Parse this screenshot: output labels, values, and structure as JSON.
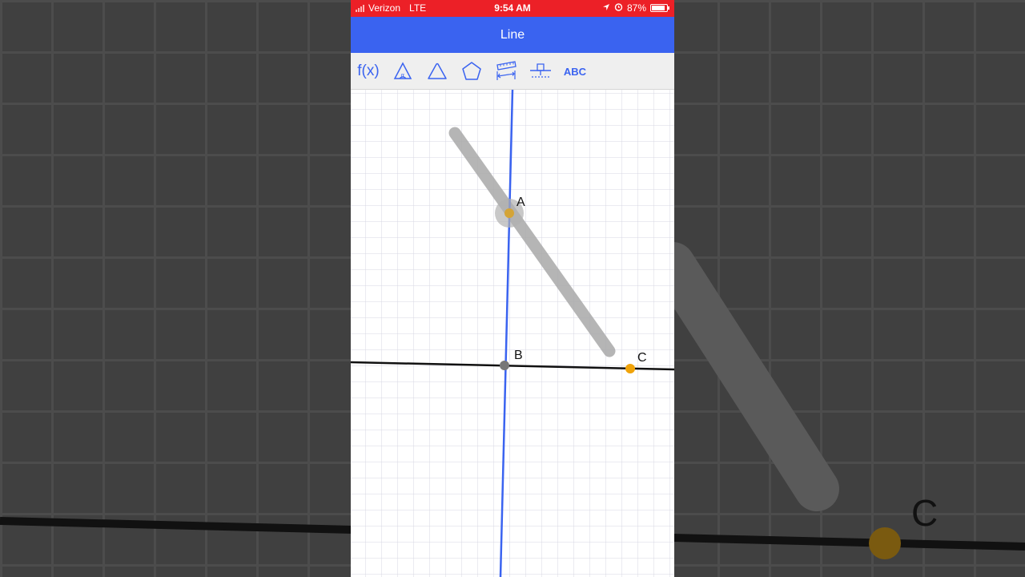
{
  "status_bar": {
    "carrier": "Verizon",
    "network": "LTE",
    "time": "9:54 AM",
    "battery": "87%",
    "battery_level": 0.87
  },
  "title": "Line",
  "toolbar": {
    "tools": [
      {
        "name": "function-tool",
        "label": "f(x)"
      },
      {
        "name": "angle-tool-icon"
      },
      {
        "name": "triangle-tool-icon"
      },
      {
        "name": "polygon-tool-icon"
      },
      {
        "name": "measure-tool-icon"
      },
      {
        "name": "transform-tool-icon"
      },
      {
        "name": "text-tool",
        "label": "ABC"
      }
    ]
  },
  "points": {
    "a": "A",
    "b": "B",
    "c": "C"
  },
  "background": {
    "c_label": "C"
  },
  "colors": {
    "status_bar": "#ec2027",
    "title_bar": "#3a63f0",
    "accent": "#3a63f0",
    "point_orange": "#f0a30a",
    "point_gray": "#777777"
  }
}
